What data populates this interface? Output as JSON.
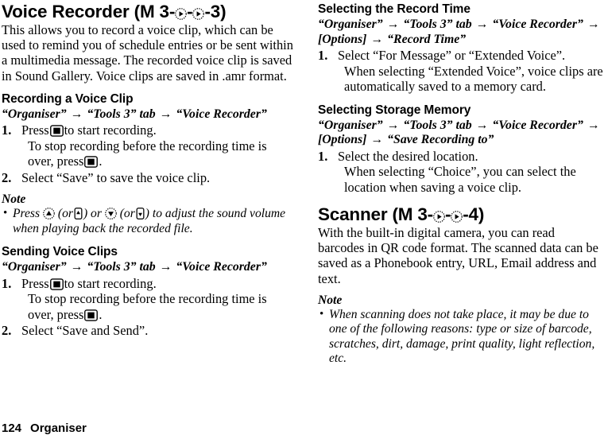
{
  "page": {
    "number": "124",
    "chapter_footer": "Organiser"
  },
  "left_column": {
    "title_prefix": "Voice Recorder",
    "title_menu_open": "(M 3-",
    "title_menu_mid": "-",
    "title_menu_end": "-3)",
    "intro": "This allows you to record a voice clip, which can be used to remind you of schedule entries or be sent within a multimedia message. The recorded voice clip is saved in Sound Gallery. Voice clips are saved in .amr format.",
    "sections": [
      {
        "heading": "Recording a Voice Clip",
        "path_parts": [
          "“Organiser”",
          "“Tools 3” tab",
          "“Voice Recorder”"
        ],
        "steps": [
          {
            "num": "1.",
            "text_before": "Press",
            "text_after": "to start recording.",
            "sub_before": "To stop recording before the recording time is over, press",
            "sub_after": "."
          },
          {
            "num": "2.",
            "text": "Select “Save” to save the voice clip."
          }
        ]
      }
    ],
    "note": {
      "heading": "Note",
      "item_a": "Press",
      "item_b": "(or",
      "item_c": ") or",
      "item_d": "(or",
      "item_e": ") to adjust the sound volume when playing back the recorded file."
    },
    "section2": {
      "heading": "Sending Voice Clips",
      "path_parts": [
        "“Organiser”",
        "“Tools 3” tab",
        "“Voice Recorder”"
      ],
      "steps": [
        {
          "num": "1.",
          "text_before": "Press",
          "text_after": "to start recording.",
          "sub_before": "To stop recording before the recording time is over, press",
          "sub_after": "."
        },
        {
          "num": "2.",
          "text": "Select “Save and Send”."
        }
      ]
    }
  },
  "right_column": {
    "section_record_time": {
      "heading": "Selecting the Record Time",
      "path_parts": [
        "“Organiser”",
        "“Tools 3” tab",
        "“Voice Recorder”",
        "[Options]",
        "“Record Time”"
      ],
      "steps": [
        {
          "num": "1.",
          "text": "Select “For Message” or “Extended Voice”.",
          "sub": "When selecting “Extended Voice”, voice clips are automatically saved to a memory card."
        }
      ]
    },
    "section_storage": {
      "heading": "Selecting Storage Memory",
      "path_parts": [
        "“Organiser”",
        "“Tools 3” tab",
        "“Voice Recorder”",
        "[Options]",
        "“Save Recording to”"
      ],
      "steps": [
        {
          "num": "1.",
          "text": "Select the desired location.",
          "sub": "When selecting “Choice”, you can select the location when saving a voice clip."
        }
      ]
    },
    "scanner": {
      "title_prefix": "Scanner",
      "title_menu_open": "(M 3-",
      "title_menu_mid": "-",
      "title_menu_end": "-4)",
      "intro": "With the built-in digital camera, you can read barcodes in QR code format. The scanned data can be saved as a Phonebook entry, URL, Email address and text.",
      "note": {
        "heading": "Note",
        "item": "When scanning does not take place, it may be due to one of the following reasons: type or size of barcode, scratches, dirt, damage, print quality, light reflection, etc."
      }
    }
  },
  "icons": {
    "nav_right": "nav-key-right-icon",
    "nav_up": "nav-key-up-icon",
    "nav_down": "nav-key-down-icon",
    "center": "center-select-key-icon",
    "side_up": "side-key-up-icon",
    "side_down": "side-key-down-icon",
    "arrow": "→"
  },
  "colors": {
    "text": "#000000",
    "background": "#ffffff"
  }
}
